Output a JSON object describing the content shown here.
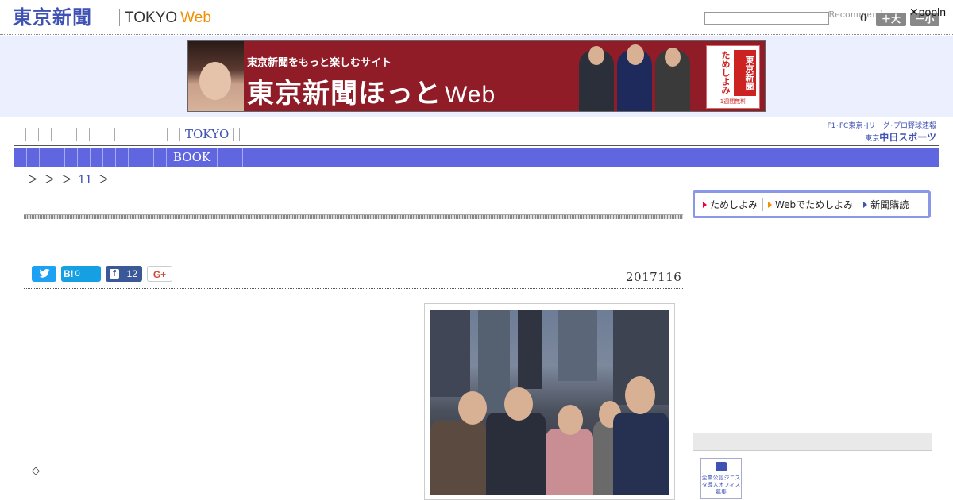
{
  "header": {
    "logo_jp": "東京新聞",
    "logo_en": "TOKYO",
    "logo_web": "Web",
    "search_placeholder": "",
    "recommend": "Recommend",
    "count": "0",
    "size_big": "＋大",
    "size_small": "－小",
    "popln": "✕popln"
  },
  "banner": {
    "tagline": "東京新聞をもっと楽しむサイト",
    "title": "東京新聞ほっと",
    "title_web": "Web",
    "book_left": "ためしよみ",
    "book_right": "東京新聞",
    "book_foot": "1週間無料"
  },
  "gnav": {
    "label": "TOKYO"
  },
  "chunichi": {
    "sub": "F1･FC東京･Jリーグ･プロ野球速報",
    "prefix": "東京",
    "main": "中日スポーツ"
  },
  "catbar": {
    "label": "BOOK"
  },
  "breadcrumb": {
    "prefix": "＞ ＞ ＞",
    "num": "11",
    "suffix": "＞"
  },
  "promo": {
    "item1": "ためしよみ",
    "item2": "Webでためしよみ",
    "item3": "新聞購読"
  },
  "social": {
    "hatena": "B!",
    "hatena_count": "0",
    "facebook_count": "12",
    "gplus": "G+"
  },
  "article": {
    "date": "2017116",
    "diamond": "◇"
  },
  "side": {
    "logo_text": "企業公認ジニスタ導入オフィス募集"
  }
}
